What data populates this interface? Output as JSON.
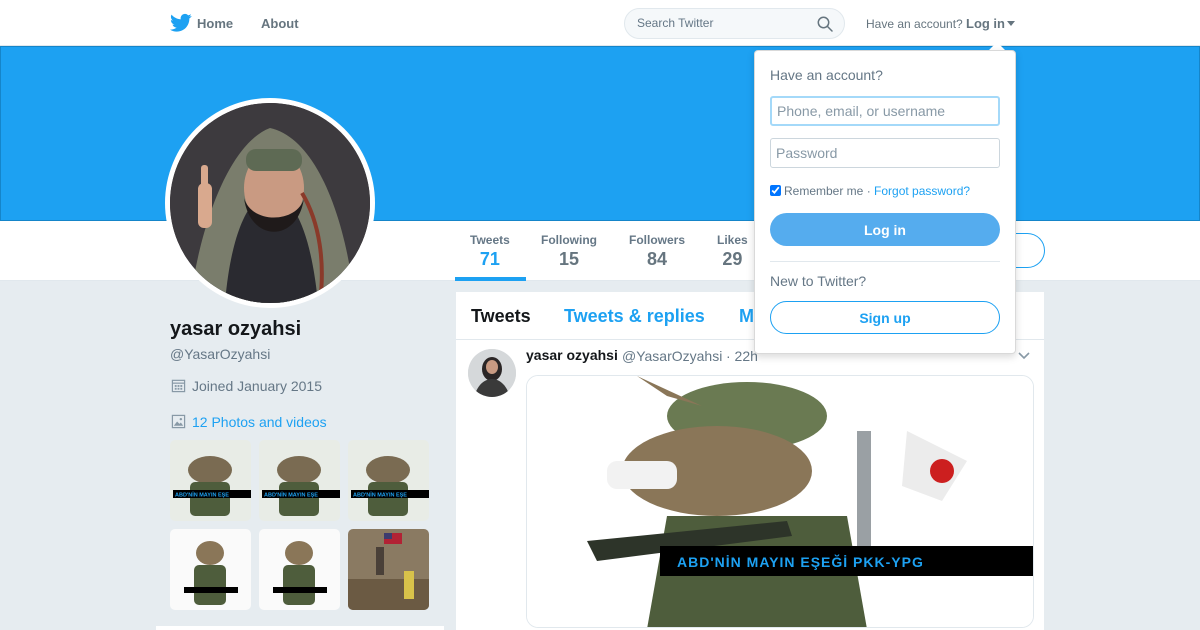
{
  "nav": {
    "home_label": "Home",
    "about_label": "About",
    "search_placeholder": "Search Twitter",
    "have_account_label": "Have an account?",
    "login_label": "Log in"
  },
  "profile": {
    "name": "yasar ozyahsi",
    "handle": "@YasarOzyahsi",
    "joined": "Joined January 2015",
    "photos_label": "12 Photos and videos"
  },
  "stats": [
    {
      "label": "Tweets",
      "value": "71"
    },
    {
      "label": "Following",
      "value": "15"
    },
    {
      "label": "Followers",
      "value": "84"
    },
    {
      "label": "Likes",
      "value": "29"
    }
  ],
  "tabs": {
    "tweets": "Tweets",
    "replies": "Tweets & replies",
    "media": "M"
  },
  "tweet": {
    "name": "yasar ozyahsi",
    "handle": "@YasarOzyahsi",
    "time": "· 22h",
    "media_caption": "ABD'NİN MAYIN EŞEĞİ PKK-YPG"
  },
  "thumb_caption": "ABD'NİN MAYIN EŞE",
  "login_dropdown": {
    "title": "Have an account?",
    "username_placeholder": "Phone, email, or username",
    "password_placeholder": "Password",
    "remember_label": "Remember me",
    "separator": " · ",
    "forgot_label": "Forgot password?",
    "login_button": "Log in",
    "new_label": "New to Twitter?",
    "signup_button": "Sign up"
  },
  "colors": {
    "brand_blue": "#1da1f2",
    "login_button": "#55acee",
    "text_primary": "#14171a",
    "text_secondary": "#657786",
    "page_bg": "#e6ecf0"
  },
  "icons": {
    "brand": "twitter-bird-icon",
    "search": "search-icon",
    "calendar": "calendar-icon",
    "photos": "image-icon",
    "tweet_menu": "chevron-down-icon"
  }
}
